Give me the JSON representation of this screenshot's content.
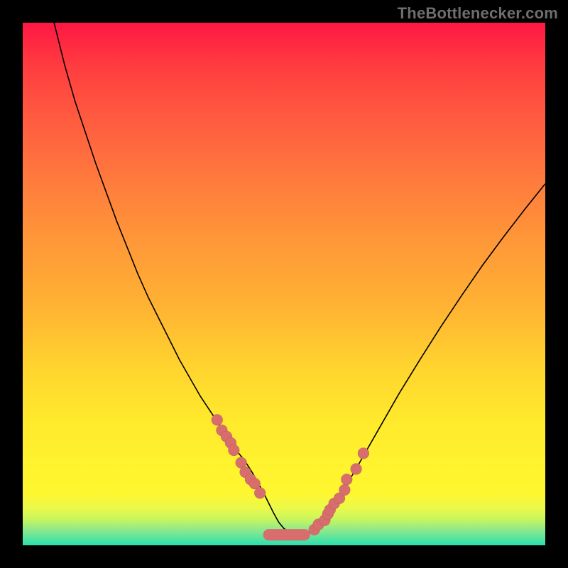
{
  "watermark": "TheBottlenecker.com",
  "colors": {
    "frame": "#000000",
    "dot": "#d86d6d",
    "curve": "#000000",
    "gradient_top": "#ff1744",
    "gradient_bottom": "#25e0b0"
  },
  "chart_data": {
    "type": "line",
    "title": "",
    "xlabel": "",
    "ylabel": "",
    "xlim": [
      0,
      100
    ],
    "ylim": [
      0,
      100
    ],
    "series": [
      {
        "name": "bottleneck-curve",
        "x": [
          6,
          8,
          10,
          12,
          14,
          16,
          18,
          20,
          22,
          24,
          26,
          28,
          30,
          32,
          34,
          36,
          38,
          40,
          41,
          42,
          43,
          44,
          45,
          46,
          47,
          48,
          49,
          50,
          51,
          52,
          53,
          54,
          55,
          56,
          58,
          60,
          64,
          68,
          72,
          76,
          80,
          84,
          88,
          92,
          96,
          100
        ],
        "y": [
          100,
          92,
          85,
          79,
          73,
          67.5,
          62,
          57,
          52,
          47.5,
          43.5,
          39.5,
          35.5,
          32,
          28.5,
          25.5,
          22.5,
          19.5,
          18,
          16.8,
          15.4,
          13.8,
          12,
          10.2,
          8.2,
          6.2,
          4.4,
          3.2,
          2.6,
          2.3,
          2.1,
          2.2,
          2.6,
          3.3,
          5.4,
          8.2,
          15,
          22,
          29,
          35.5,
          41.8,
          47.8,
          53.6,
          59,
          64.2,
          69.2
        ]
      }
    ],
    "markers": {
      "comment": "Salmon sample dots along the curve near the valley",
      "x": [
        37.2,
        38.1,
        39.0,
        39.8,
        40.4,
        41.8,
        42.6,
        43.6,
        44.4,
        45.4,
        55.8,
        56.6,
        57.8,
        58.4,
        58.8,
        59.6,
        60.6,
        61.6,
        62.0,
        63.8,
        65.2
      ],
      "y": [
        24.0,
        22.0,
        20.8,
        19.6,
        18.2,
        15.8,
        14.0,
        12.6,
        11.8,
        10.0,
        3.0,
        4.0,
        4.8,
        6.0,
        6.8,
        8.0,
        9.0,
        10.6,
        12.6,
        14.6,
        17.6
      ]
    },
    "flat_bottom": {
      "comment": "Wide salmon strip at valley bottom",
      "x_start": 46.0,
      "x_end": 55.0,
      "y": 2.0,
      "thickness_pct": 2.2
    }
  }
}
